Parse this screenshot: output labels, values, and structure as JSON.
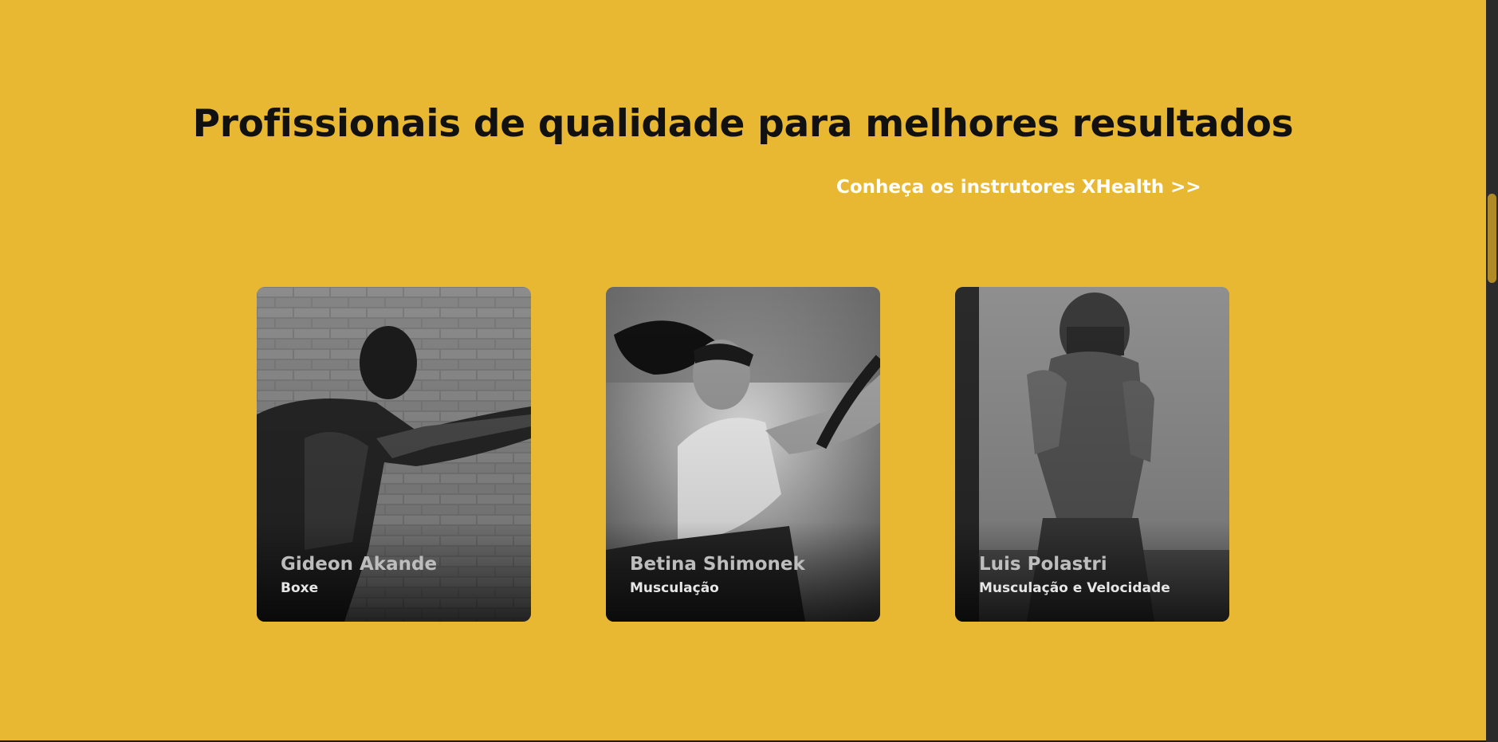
{
  "section": {
    "title": "Profissionais de qualidade para melhores resultados",
    "cta_label": "Conheça os instrutores XHealth >>"
  },
  "instructors": [
    {
      "name": "Gideon Akande",
      "specialty": "Boxe"
    },
    {
      "name": "Betina Shimonek",
      "specialty": "Musculação"
    },
    {
      "name": "Luis Polastri",
      "specialty": "Musculação e Velocidade"
    }
  ],
  "colors": {
    "background": "#e9b833",
    "title": "#111111",
    "cta": "#ffffff",
    "scrollbar_thumb": "#b08a24"
  }
}
